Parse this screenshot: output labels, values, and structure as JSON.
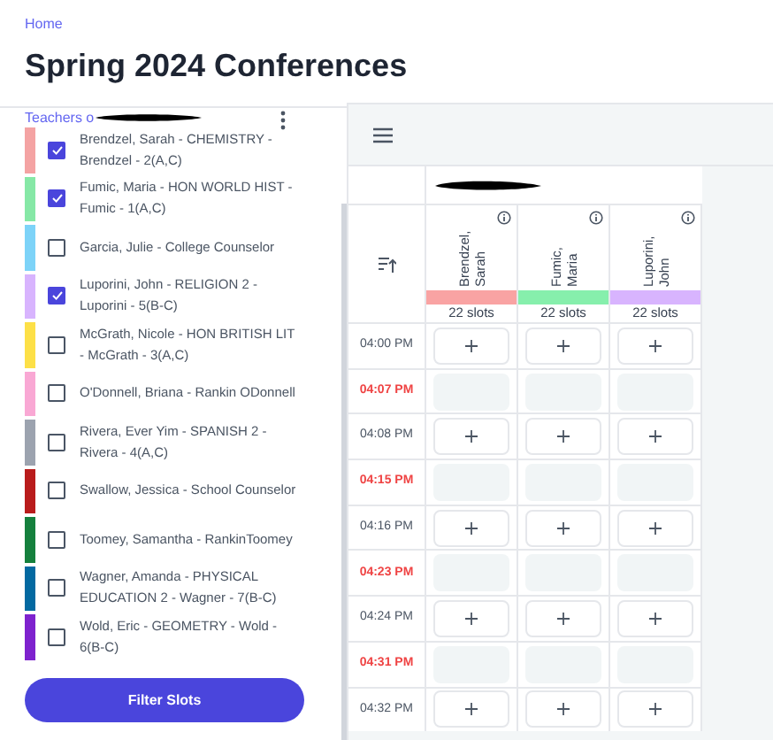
{
  "breadcrumb": "Home",
  "title": "Spring 2024 Conferences",
  "teacher_list": {
    "label": "Teachers o",
    "items": [
      {
        "name": "Brendzel, Sarah - CHEMISTRY - Brendzel - 2(A,C)",
        "color": "#f4a3a3",
        "checked": true
      },
      {
        "name": "Fumic, Maria - HON WORLD HIST - Fumic - 1(A,C)",
        "color": "#86e8a6",
        "checked": true
      },
      {
        "name": "Garcia, Julie - College Counselor",
        "color": "#7dd3f8",
        "checked": false
      },
      {
        "name": "Luporini, John - RELIGION 2 - Luporini - 5(B-C)",
        "color": "#d8b4fe",
        "checked": true
      },
      {
        "name": "McGrath, Nicole - HON BRITISH LIT - McGrath - 3(A,C)",
        "color": "#fde047",
        "checked": false
      },
      {
        "name": "O'Donnell, Briana - Rankin ODonnell",
        "color": "#f9a8d4",
        "checked": false
      },
      {
        "name": "Rivera, Ever Yim - SPANISH 2 - Rivera - 4(A,C)",
        "color": "#9ca3af",
        "checked": false
      },
      {
        "name": "Swallow, Jessica - School Counselor",
        "color": "#b91c1c",
        "checked": false
      },
      {
        "name": "Toomey, Samantha - RankinToomey",
        "color": "#15803d",
        "checked": false
      },
      {
        "name": "Wagner, Amanda - PHYSICAL EDUCATION 2 - Wagner - 7(B-C)",
        "color": "#0369a1",
        "checked": false
      },
      {
        "name": "Wold, Eric - GEOMETRY - Wold - 6(B-C)",
        "color": "#7e22ce",
        "checked": false
      }
    ]
  },
  "filter_button": "Filter Slots",
  "schedule": {
    "columns": [
      {
        "name": "Brendzel, Sarah",
        "color": "#f9a3a3",
        "slots": "22 slots"
      },
      {
        "name": "Fumic, Maria",
        "color": "#86efac",
        "slots": "22 slots"
      },
      {
        "name": "Luporini, John",
        "color": "#d8b4fe",
        "slots": "22 slots"
      }
    ],
    "rows": [
      {
        "time": "04:00 PM",
        "available": true
      },
      {
        "time": "04:07 PM",
        "available": false
      },
      {
        "time": "04:08 PM",
        "available": true
      },
      {
        "time": "04:15 PM",
        "available": false
      },
      {
        "time": "04:16 PM",
        "available": true
      },
      {
        "time": "04:23 PM",
        "available": false
      },
      {
        "time": "04:24 PM",
        "available": true
      },
      {
        "time": "04:31 PM",
        "available": false
      },
      {
        "time": "04:32 PM",
        "available": true
      }
    ]
  }
}
